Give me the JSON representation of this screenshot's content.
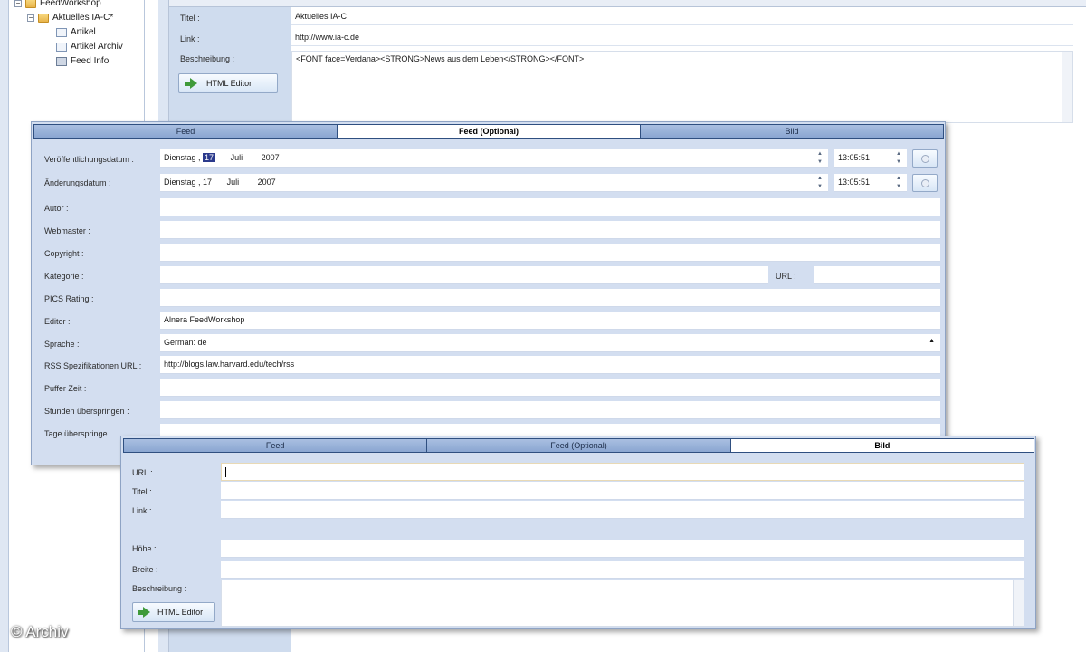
{
  "tree": {
    "root": "FeedWorkshop",
    "feed": "Aktuelles IA-C*",
    "children": [
      "Artikel",
      "Artikel Archiv",
      "Feed Info"
    ]
  },
  "background_form": {
    "title_label": "Titel :",
    "title_value": "Aktuelles IA-C",
    "link_label": "Link :",
    "link_value": "http://www.ia-c.de",
    "desc_label": "Beschreibung :",
    "desc_value": "<FONT face=Verdana><STRONG>News aus dem Leben</STRONG></FONT>",
    "html_editor": "HTML Editor"
  },
  "feed_window": {
    "tabs": [
      "Feed",
      "Feed (Optional)",
      "Bild"
    ],
    "active_tab": "Feed (Optional)",
    "pub_date_label": "Veröffentlichungsdatum :",
    "pub_date": {
      "weekday": "Dienstag ,",
      "day": "17",
      "month": "Juli",
      "year": "2007"
    },
    "pub_time": "13:05:51",
    "mod_date_label": "Änderungsdatum :",
    "mod_date": {
      "weekday": "Dienstag ,",
      "day": "17",
      "month": "Juli",
      "year": "2007"
    },
    "mod_time": "13:05:51",
    "author_label": "Autor :",
    "webmaster_label": "Webmaster :",
    "copyright_label": "Copyright :",
    "category_label": "Kategorie :",
    "url_label": "URL :",
    "pics_label": "PICS Rating :",
    "editor_label": "Editor :",
    "editor_value": "Alnera FeedWorkshop",
    "language_label": "Sprache :",
    "language_value": "German: de",
    "rss_spec_label": "RSS Spezifikationen URL :",
    "rss_spec_value": "http://blogs.law.harvard.edu/tech/rss",
    "buffer_label": "Puffer Zeit :",
    "skip_hours_label": "Stunden überspringen :",
    "skip_days_label": "Tage überspringe"
  },
  "image_window": {
    "tabs": [
      "Feed",
      "Feed (Optional)",
      "Bild"
    ],
    "active_tab": "Bild",
    "url_label": "URL :",
    "title_label": "Titel :",
    "link_label": "Link :",
    "height_label": "Höhe :",
    "width_label": "Breite :",
    "desc_label": "Beschreibung :",
    "html_editor": "HTML Editor"
  },
  "watermark": "© Archiv",
  "colors": {
    "tab_active": "#ffffff",
    "tab_inactive": "#8aa6d1",
    "window_bg": "#d3def0",
    "label_column": "#cfdcee"
  }
}
